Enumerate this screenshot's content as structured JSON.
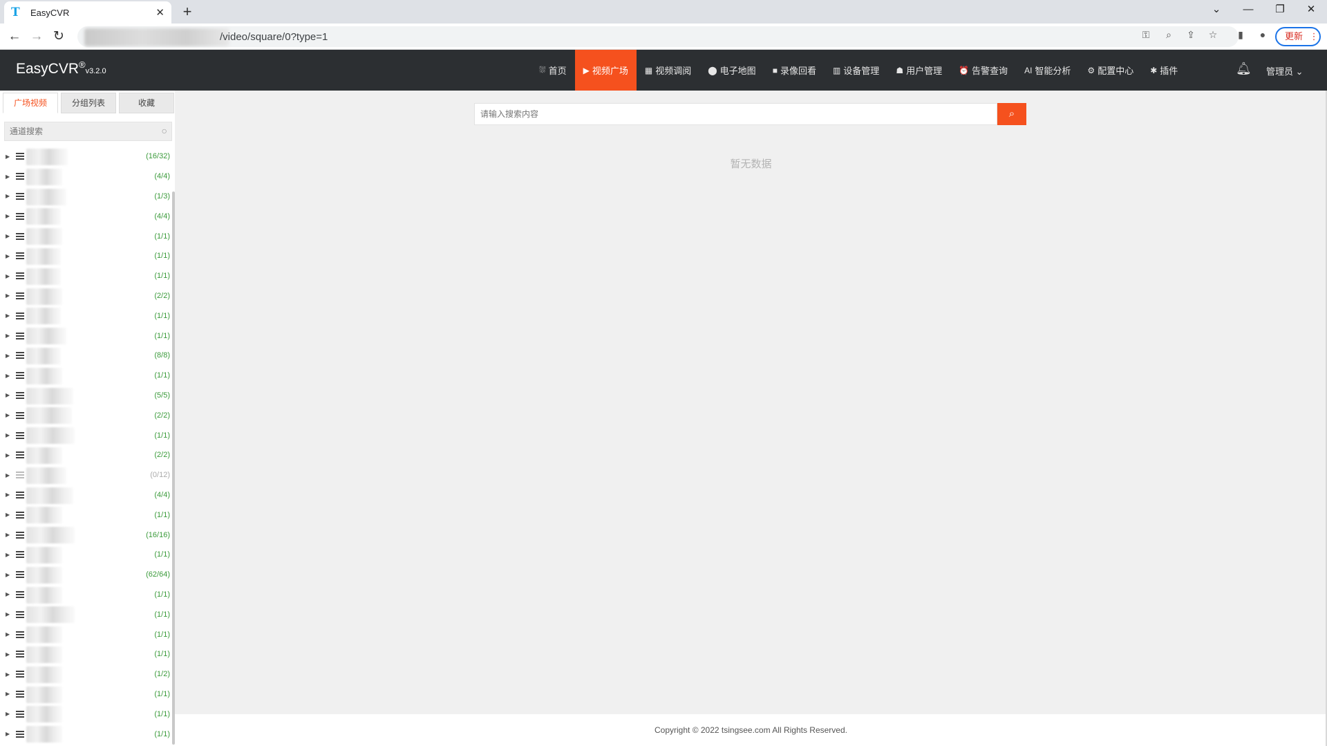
{
  "browser": {
    "tab_title": "EasyCVR",
    "tab_favicon": "T",
    "url_path": "/video/square/0?type=1",
    "update_label": "更新"
  },
  "header": {
    "brand": "EasyCVR",
    "brand_reg": "®",
    "version": "v3.2.0",
    "nav": [
      {
        "label": "首页",
        "icon": "dashboard-icon",
        "glyph": "⛆"
      },
      {
        "label": "视频广场",
        "icon": "play-icon",
        "glyph": "▶"
      },
      {
        "label": "视频调阅",
        "icon": "grid-icon",
        "glyph": "▦"
      },
      {
        "label": "电子地图",
        "icon": "map-pin-icon",
        "glyph": "⬤"
      },
      {
        "label": "录像回看",
        "icon": "camera-icon",
        "glyph": "■"
      },
      {
        "label": "设备管理",
        "icon": "device-icon",
        "glyph": "▥"
      },
      {
        "label": "用户管理",
        "icon": "user-icon",
        "glyph": "☗"
      },
      {
        "label": "告警查询",
        "icon": "alarm-icon",
        "glyph": "⏰"
      },
      {
        "label": "智能分析",
        "icon": "ai-icon",
        "glyph": "AI"
      },
      {
        "label": "配置中心",
        "icon": "gear-icon",
        "glyph": "⚙"
      },
      {
        "label": "插件",
        "icon": "puzzle-icon",
        "glyph": "✱"
      }
    ],
    "active_nav": "视频广场",
    "admin_label": "管理员",
    "accent_color": "#f5511e"
  },
  "sidebar": {
    "tabs": [
      "广场视频",
      "分组列表",
      "收藏"
    ],
    "search_placeholder": "通道搜索",
    "tree": [
      {
        "count": "(16/32)"
      },
      {
        "count": "(4/4)"
      },
      {
        "count": "(1/3)"
      },
      {
        "count": "(4/4)"
      },
      {
        "count": "(1/1)"
      },
      {
        "count": "(1/1)"
      },
      {
        "count": "(1/1)"
      },
      {
        "count": "(2/2)"
      },
      {
        "count": "(1/1)"
      },
      {
        "count": "(1/1)"
      },
      {
        "count": "(8/8)"
      },
      {
        "count": "(1/1)"
      },
      {
        "count": "(5/5)"
      },
      {
        "count": "(2/2)"
      },
      {
        "count": "(1/1)"
      },
      {
        "count": "(2/2)"
      },
      {
        "count": "(0/12)",
        "offline": true
      },
      {
        "count": "(4/4)"
      },
      {
        "count": "(1/1)"
      },
      {
        "count": "(16/16)"
      },
      {
        "count": "(1/1)"
      },
      {
        "count": "(62/64)"
      },
      {
        "count": "(1/1)"
      },
      {
        "count": "(1/1)"
      },
      {
        "count": "(1/1)"
      },
      {
        "count": "(1/1)"
      },
      {
        "count": "(1/2)"
      },
      {
        "count": "(1/1)"
      },
      {
        "count": "(1/1)"
      },
      {
        "count": "(1/1)"
      }
    ]
  },
  "main": {
    "search_placeholder": "请输入搜索内容",
    "empty_text": "暂无数据",
    "copyright": "Copyright © 2022 tsingsee.com All Rights Reserved."
  }
}
